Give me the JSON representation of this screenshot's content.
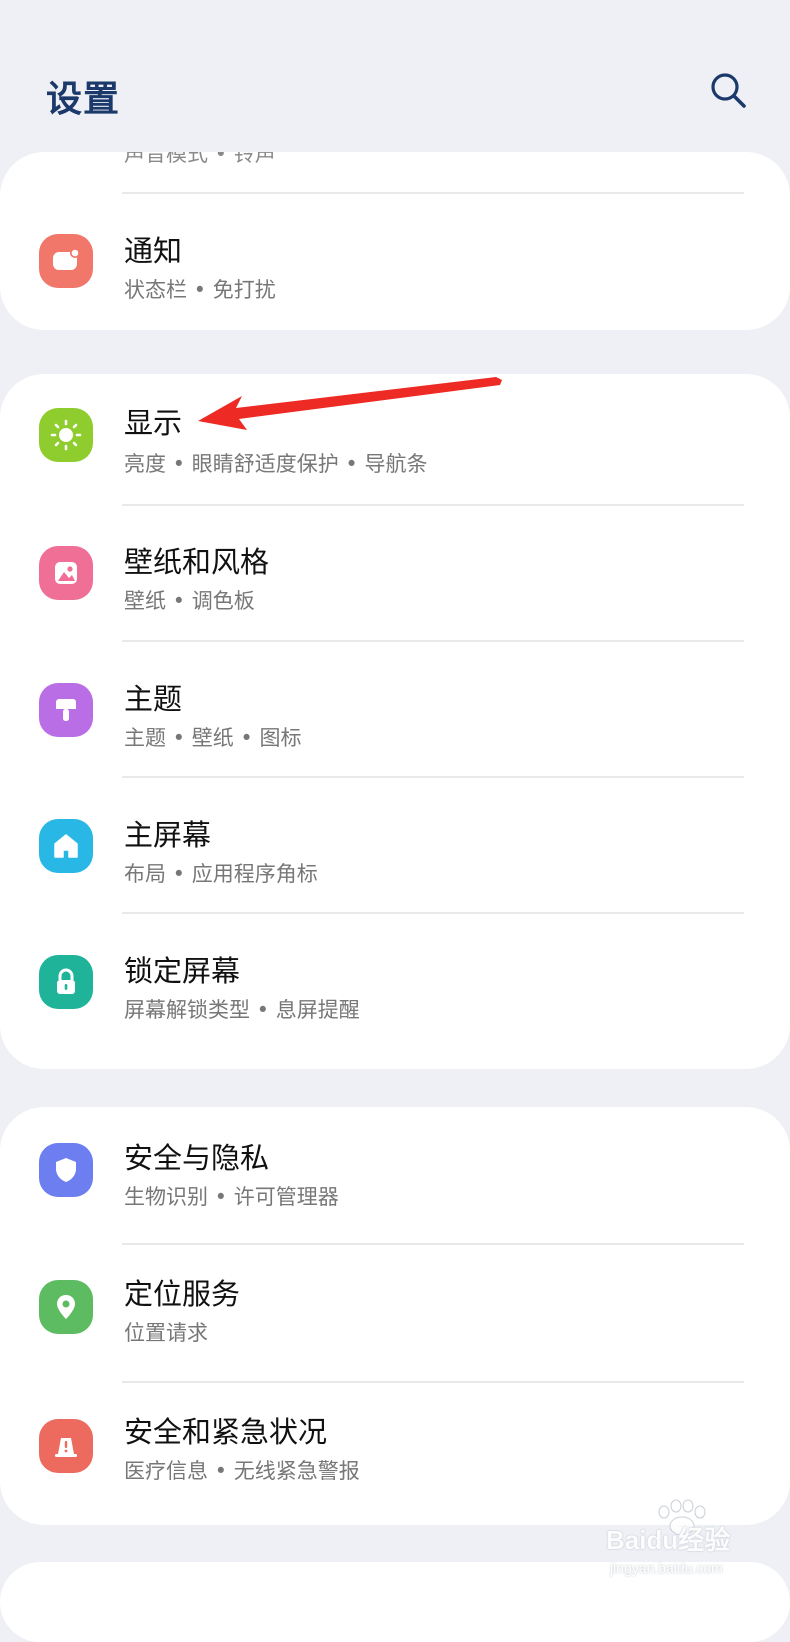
{
  "header": {
    "title": "设置",
    "search_icon": "search-icon"
  },
  "top_card": {
    "partial_subtitle": "声音模式 • 铃声",
    "items": [
      {
        "title": "通知",
        "subtitle": "状态栏 • 免打扰",
        "icon": "notification-icon",
        "color": "#f0776a"
      }
    ]
  },
  "display_card": {
    "items": [
      {
        "title": "显示",
        "subtitle": "亮度 • 眼睛舒适度保护 • 导航条",
        "icon": "sun-icon",
        "color": "#8fcc2e"
      },
      {
        "title": "壁纸和风格",
        "subtitle": "壁纸 • 调色板",
        "icon": "image-icon",
        "color": "#ef6f97"
      },
      {
        "title": "主题",
        "subtitle": "主题 • 壁纸 • 图标",
        "icon": "paintbrush-icon",
        "color": "#b96ee6"
      },
      {
        "title": "主屏幕",
        "subtitle": "布局 • 应用程序角标",
        "icon": "home-icon",
        "color": "#29b7e6"
      },
      {
        "title": "锁定屏幕",
        "subtitle": "屏幕解锁类型 • 息屏提醒",
        "icon": "lock-icon",
        "color": "#1fb39a"
      }
    ]
  },
  "security_card": {
    "items": [
      {
        "title": "安全与隐私",
        "subtitle": "生物识别 • 许可管理器",
        "icon": "shield-icon",
        "color": "#6c7ef0"
      },
      {
        "title": "定位服务",
        "subtitle": "位置请求",
        "icon": "location-pin-icon",
        "color": "#5dbb62"
      },
      {
        "title": "安全和紧急状况",
        "subtitle": "医疗信息 • 无线紧急警报",
        "icon": "emergency-icon",
        "color": "#ec6a5e"
      }
    ]
  },
  "annotation": {
    "arrow_color": "#ee2a24"
  },
  "watermark": {
    "brand": "Baidu经验",
    "url": "jingyan.baidu.com"
  }
}
